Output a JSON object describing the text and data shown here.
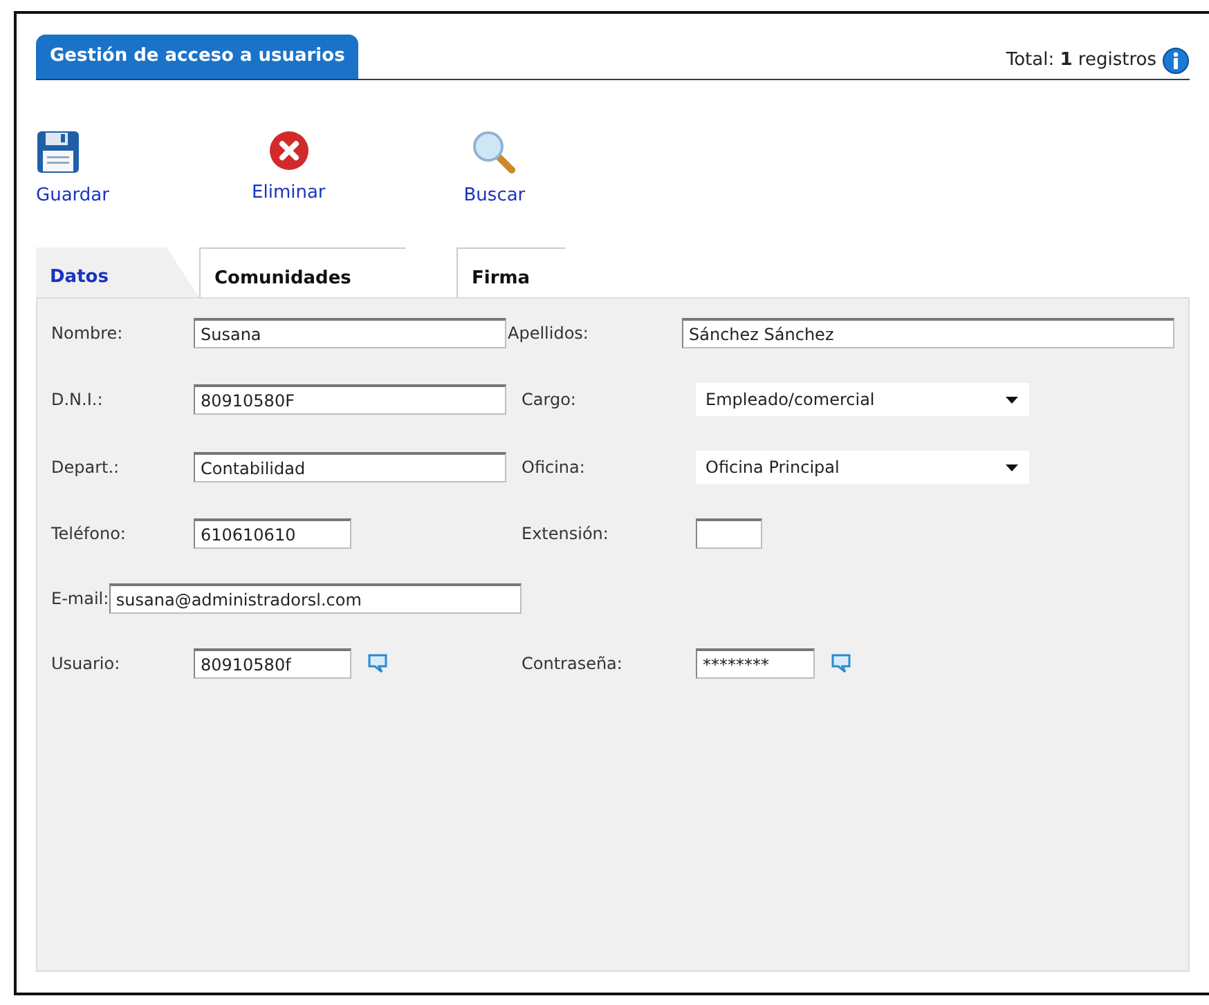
{
  "header": {
    "title": "Gestión de acceso a usuarios",
    "total": "Total: **1** registros"
  },
  "toolbar": [
    {
      "kind": "save",
      "label": "Guardar"
    },
    {
      "kind": "delete",
      "label": "Eliminar"
    },
    {
      "kind": "search",
      "label": "Buscar"
    }
  ],
  "tabs": [
    {
      "label": "Datos",
      "selected": true
    },
    {
      "label": "Comunidades",
      "selected": false
    },
    {
      "label": "Firma",
      "selected": false
    }
  ],
  "rows": [
    {
      "fields": [
        {
          "kind": "text",
          "label": "Nombre:",
          "value": "Susana"
        },
        {
          "kind": "text",
          "label": "Apellidos:",
          "value": "Sánchez Sánchez"
        }
      ]
    },
    {
      "fields": [
        {
          "kind": "text",
          "label": "D.N.I.:",
          "value": "80910580F"
        },
        {
          "kind": "select",
          "label": "Cargo:",
          "value": "Empleado/comercial"
        }
      ]
    },
    {
      "fields": [
        {
          "kind": "text",
          "label": "Depart.:",
          "value": "Contabilidad"
        },
        {
          "kind": "select",
          "label": "Oficina:",
          "value": "Oficina Principal"
        }
      ]
    },
    {
      "fields": [
        {
          "kind": "short",
          "label": "Teléfono:",
          "value": "610610610"
        },
        {
          "kind": "tiny",
          "label": "Extensión:"
        }
      ]
    },
    {
      "fields": [
        {
          "kind": "wide",
          "label": "E-mail:",
          "value": "susana@administradorsl.com"
        }
      ]
    },
    {
      "fields": [
        {
          "kind": "short",
          "label": "Usuario:",
          "value": "80910580f",
          "help": true
        },
        {
          "kind": "password",
          "label": "Contraseña:",
          "value": "********",
          "help": true
        }
      ]
    }
  ]
}
